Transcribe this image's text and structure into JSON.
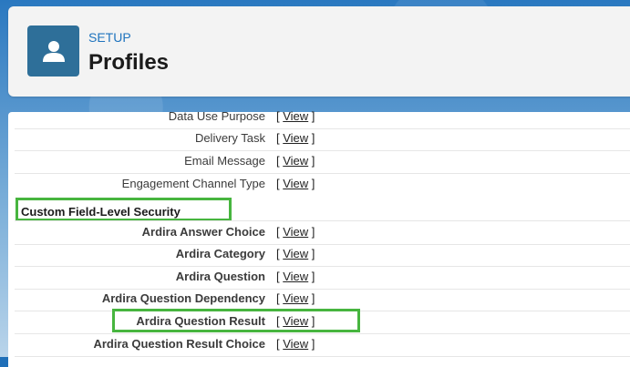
{
  "header": {
    "breadcrumb": "SETUP",
    "title": "Profiles",
    "icon": "user-icon"
  },
  "object_rows": [
    {
      "label": "Data Use Purpose",
      "view": "View"
    },
    {
      "label": "Delivery Task",
      "view": "View"
    },
    {
      "label": "Email Message",
      "view": "View"
    },
    {
      "label": "Engagement Channel Type",
      "view": "View"
    }
  ],
  "section": {
    "title": "Custom Field-Level Security"
  },
  "field_rows": [
    {
      "label": "Ardira Answer Choice",
      "view": "View"
    },
    {
      "label": "Ardira Category",
      "view": "View"
    },
    {
      "label": "Ardira Question",
      "view": "View"
    },
    {
      "label": "Ardira Question Dependency",
      "view": "View"
    },
    {
      "label": "Ardira Question Result",
      "view": "View"
    },
    {
      "label": "Ardira Question Result Choice",
      "view": "View"
    }
  ],
  "colors": {
    "highlight": "#47b53f",
    "icon_bg": "#2e6f99",
    "setup_text": "#1e73be"
  }
}
